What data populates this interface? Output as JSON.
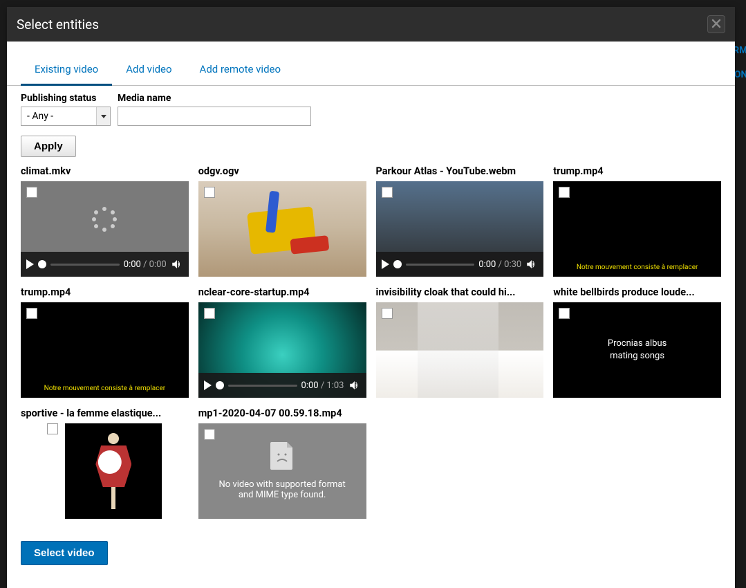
{
  "backdrop": {
    "label_rm": "RM",
    "label_on": "ON"
  },
  "modal": {
    "title": "Select entities",
    "tabs": [
      "Existing video",
      "Add video",
      "Add remote video"
    ],
    "active_tab": 0,
    "filters": {
      "status_label": "Publishing status",
      "status_value": "- Any -",
      "name_label": "Media name",
      "name_value": "",
      "apply_label": "Apply"
    },
    "items": [
      {
        "title": "climat.mkv",
        "kind": "spinner",
        "controls": {
          "time": "0:00",
          "duration": "0:00"
        }
      },
      {
        "title": "odgv.ogv",
        "kind": "lego"
      },
      {
        "title": "Parkour Atlas - YouTube.webm",
        "kind": "factory",
        "controls": {
          "time": "0:00",
          "duration": "0:30"
        }
      },
      {
        "title": "trump.mp4",
        "kind": "black_caption",
        "caption": "Notre mouvement consiste à remplacer"
      },
      {
        "title": "trump.mp4",
        "kind": "black_caption",
        "caption": "Notre mouvement consiste à remplacer"
      },
      {
        "title": "nclear-core-startup.mp4",
        "kind": "nuclear",
        "controls": {
          "time": "0:00",
          "duration": "1:03"
        }
      },
      {
        "title": "invisibility cloak that could hi...",
        "kind": "wall"
      },
      {
        "title": "white bellbirds produce loude...",
        "kind": "black_text",
        "text_line1": "Procnias albus",
        "text_line2": "mating songs"
      },
      {
        "title": "sportive - la femme elastique...",
        "kind": "acrobat"
      },
      {
        "title": "mp1-2020-04-07 00.59.18.mp4",
        "kind": "error",
        "error_text": "No video with supported format and MIME type found."
      }
    ],
    "footer": {
      "select_label": "Select video"
    }
  }
}
